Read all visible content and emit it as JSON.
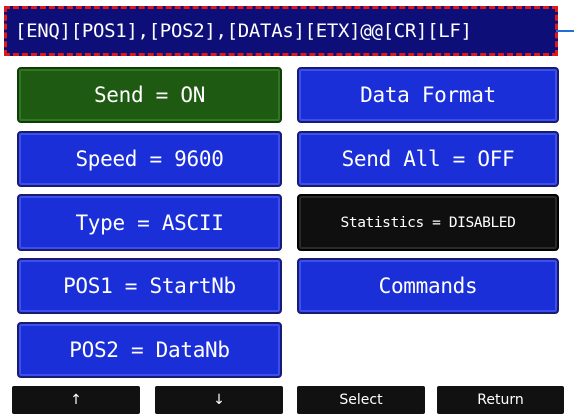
{
  "header": {
    "text": "[ENQ][POS1],[POS2],[DATAs][ETX]@@[CR][LF]"
  },
  "buttons": {
    "send": "Send = ON",
    "data_format": "Data Format",
    "speed": "Speed = 9600",
    "send_all": "Send All = OFF",
    "type": "Type = ASCII",
    "statistics": "Statistics = DISABLED",
    "pos1": "POS1 = StartNb",
    "commands": "Commands",
    "pos2": "POS2 = DataNb"
  },
  "nav": {
    "up": "↑",
    "down": "↓",
    "select": "Select",
    "return": "Return"
  },
  "colors": {
    "header_bg": "#0e0e78",
    "header_border": "#e01818",
    "button_blue": "#1a2fd8",
    "button_on": "#1e5a12",
    "button_disabled": "#0f0f0f",
    "nav_bg": "#111111"
  }
}
